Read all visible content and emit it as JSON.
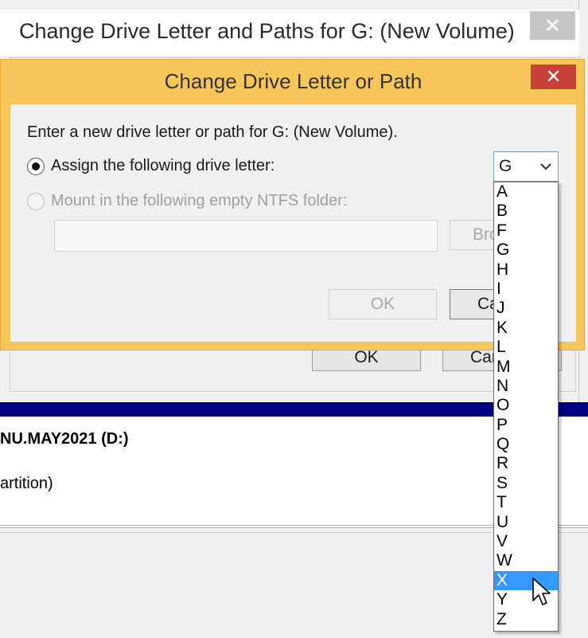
{
  "background_window": {
    "title": "Change Drive Letter and Paths for G: (New Volume)",
    "close_glyph": "✕",
    "ok_label": "OK",
    "cancel_label": "Cancel"
  },
  "volume": {
    "name": "NU.MAY2021  (D:)",
    "type": "artition)"
  },
  "dialog": {
    "title": "Change Drive Letter or Path",
    "close_glyph": "✕",
    "prompt": "Enter a new drive letter or path for G: (New Volume).",
    "assign_label": "Assign the following drive letter:",
    "mount_label": "Mount in the following empty NTFS folder:",
    "folder_value": "",
    "browse_label": "Browse...",
    "ok_label": "OK",
    "cancel_label": "Cancel"
  },
  "drive_select": {
    "value": "G",
    "options": [
      "A",
      "B",
      "F",
      "G",
      "H",
      "I",
      "J",
      "K",
      "L",
      "M",
      "N",
      "O",
      "P",
      "Q",
      "R",
      "S",
      "T",
      "U",
      "V",
      "W",
      "X",
      "Y",
      "Z"
    ],
    "highlighted": "X"
  },
  "colors": {
    "dialog_frame": "#f7c65a",
    "close_red": "#c9403a",
    "highlight": "#3399ff",
    "volume_bar": "#000080"
  }
}
